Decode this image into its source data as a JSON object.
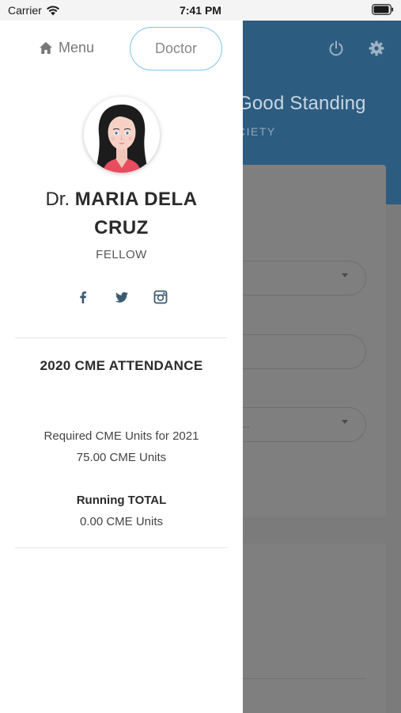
{
  "status_bar": {
    "carrier": "Carrier",
    "time": "7:41 PM"
  },
  "drawer": {
    "menu_label": "Menu",
    "doctor_tab_label": "Doctor",
    "doctor_prefix": "Dr.",
    "doctor_name_line1": "MARIA DELA",
    "doctor_name_line2": "CRUZ",
    "rank": "FELLOW",
    "social_icons": [
      "facebook-icon",
      "twitter-icon",
      "instagram-icon"
    ],
    "cme_heading": "2020 CME ATTENDANCE",
    "required_label": "Required CME Units for 2021",
    "required_value": "75.00 CME Units",
    "running_total_label": "Running TOTAL",
    "running_total_value": "0.00 CME Units"
  },
  "background_app": {
    "standing_title": "Good Standing",
    "standing_subtitle": "CIETY",
    "dropdown_placeholder": "..."
  },
  "colors": {
    "header_blue": "#2c5c80",
    "doctor_tab_border": "#7fc3e8",
    "overlay_gray": "#7b7b7b"
  }
}
